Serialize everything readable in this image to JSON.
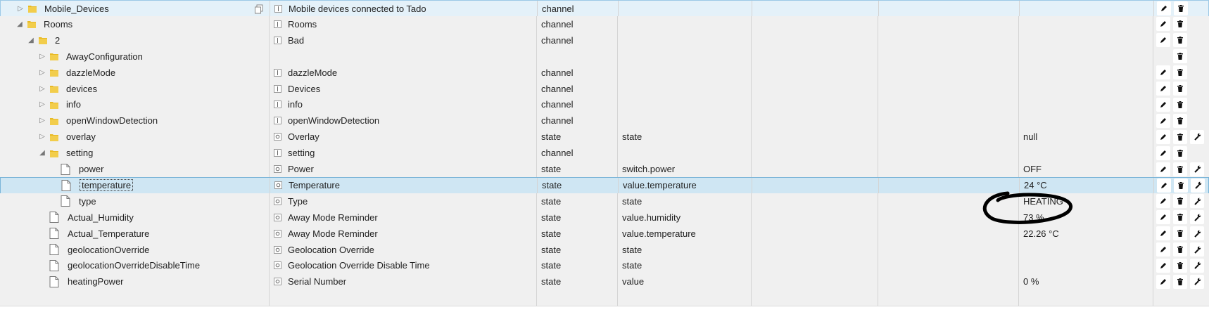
{
  "rows": [
    {
      "name": "Mobile_Devices",
      "level": 1,
      "tw": "closed",
      "icon": "folder",
      "role": "Mobile devices connected to Tado",
      "type": "channel",
      "role2": "",
      "val": "",
      "edit": true,
      "del": true,
      "wrench": false,
      "copy": true
    },
    {
      "name": "Rooms",
      "level": 1,
      "tw": "open",
      "icon": "folder",
      "role": "Rooms",
      "type": "channel",
      "role2": "",
      "val": "",
      "edit": true,
      "del": true,
      "wrench": false
    },
    {
      "name": "2",
      "level": 2,
      "tw": "open",
      "icon": "folder",
      "role": "Bad",
      "type": "channel",
      "role2": "",
      "val": "",
      "edit": true,
      "del": true,
      "wrench": false
    },
    {
      "name": "AwayConfiguration",
      "level": 3,
      "tw": "closed",
      "icon": "folder",
      "role": "",
      "type": "",
      "role2": "",
      "val": "",
      "edit": false,
      "del": true,
      "wrench": false
    },
    {
      "name": "dazzleMode",
      "level": 3,
      "tw": "closed",
      "icon": "folder",
      "role": "dazzleMode",
      "type": "channel",
      "role2": "",
      "val": "",
      "edit": true,
      "del": true,
      "wrench": false
    },
    {
      "name": "devices",
      "level": 3,
      "tw": "closed",
      "icon": "folder",
      "role": "Devices",
      "type": "channel",
      "role2": "",
      "val": "",
      "edit": true,
      "del": true,
      "wrench": false
    },
    {
      "name": "info",
      "level": 3,
      "tw": "closed",
      "icon": "folder",
      "role": "info",
      "type": "channel",
      "role2": "",
      "val": "",
      "edit": true,
      "del": true,
      "wrench": false
    },
    {
      "name": "openWindowDetection",
      "level": 3,
      "tw": "closed",
      "icon": "folder",
      "role": "openWindowDetection",
      "type": "channel",
      "role2": "",
      "val": "",
      "edit": true,
      "del": true,
      "wrench": false
    },
    {
      "name": "overlay",
      "level": 3,
      "tw": "closed",
      "icon": "folder",
      "role": "Overlay",
      "type": "state",
      "role2": "state",
      "val": "null",
      "edit": true,
      "del": true,
      "wrench": true,
      "stateicon": true
    },
    {
      "name": "setting",
      "level": 3,
      "tw": "open",
      "icon": "folder",
      "role": "setting",
      "type": "channel",
      "role2": "",
      "val": "",
      "edit": true,
      "del": true,
      "wrench": false
    },
    {
      "name": "power",
      "level": 4,
      "tw": "",
      "icon": "file",
      "role": "Power",
      "type": "state",
      "role2": "switch.power",
      "val": "OFF",
      "edit": true,
      "del": true,
      "wrench": true,
      "stateicon": true
    },
    {
      "name": "temperature",
      "level": 4,
      "tw": "",
      "icon": "file",
      "role": "Temperature",
      "type": "state",
      "role2": "value.temperature",
      "val": "24 °C",
      "edit": true,
      "del": true,
      "wrench": true,
      "stateicon": true,
      "selected": true
    },
    {
      "name": "type",
      "level": 4,
      "tw": "",
      "icon": "file",
      "role": "Type",
      "type": "state",
      "role2": "state",
      "val": "HEATING",
      "edit": true,
      "del": true,
      "wrench": true,
      "stateicon": true
    },
    {
      "name": "Actual_Humidity",
      "level": 3,
      "tw": "",
      "icon": "file",
      "role": "Away Mode Reminder",
      "type": "state",
      "role2": "value.humidity",
      "val": "73 %",
      "edit": true,
      "del": true,
      "wrench": true,
      "stateicon": true
    },
    {
      "name": "Actual_Temperature",
      "level": 3,
      "tw": "",
      "icon": "file",
      "role": "Away Mode Reminder",
      "type": "state",
      "role2": "value.temperature",
      "val": "22.26 °C",
      "edit": true,
      "del": true,
      "wrench": true,
      "stateicon": true
    },
    {
      "name": "geolocationOverride",
      "level": 3,
      "tw": "",
      "icon": "file",
      "role": "Geolocation Override",
      "type": "state",
      "role2": "state",
      "val": "",
      "edit": true,
      "del": true,
      "wrench": true,
      "stateicon": true
    },
    {
      "name": "geolocationOverrideDisableTime",
      "level": 3,
      "tw": "",
      "icon": "file",
      "role": "Geolocation Override Disable Time",
      "type": "state",
      "role2": "state",
      "val": "",
      "edit": true,
      "del": true,
      "wrench": true,
      "stateicon": true
    },
    {
      "name": "heatingPower",
      "level": 3,
      "tw": "",
      "icon": "file",
      "role": "Serial Number",
      "type": "state",
      "role2": "value",
      "val": "0 %",
      "edit": true,
      "del": true,
      "wrench": true,
      "stateicon": true
    },
    {
      "name": "",
      "level": 3,
      "tw": "",
      "icon": "",
      "role": "",
      "type": "",
      "role2": "",
      "val": "",
      "edit": false,
      "del": false,
      "wrench": false
    }
  ],
  "colors": {
    "folder": "#e8b923",
    "selected": "#cfe6f3",
    "annotation": "#000000"
  }
}
